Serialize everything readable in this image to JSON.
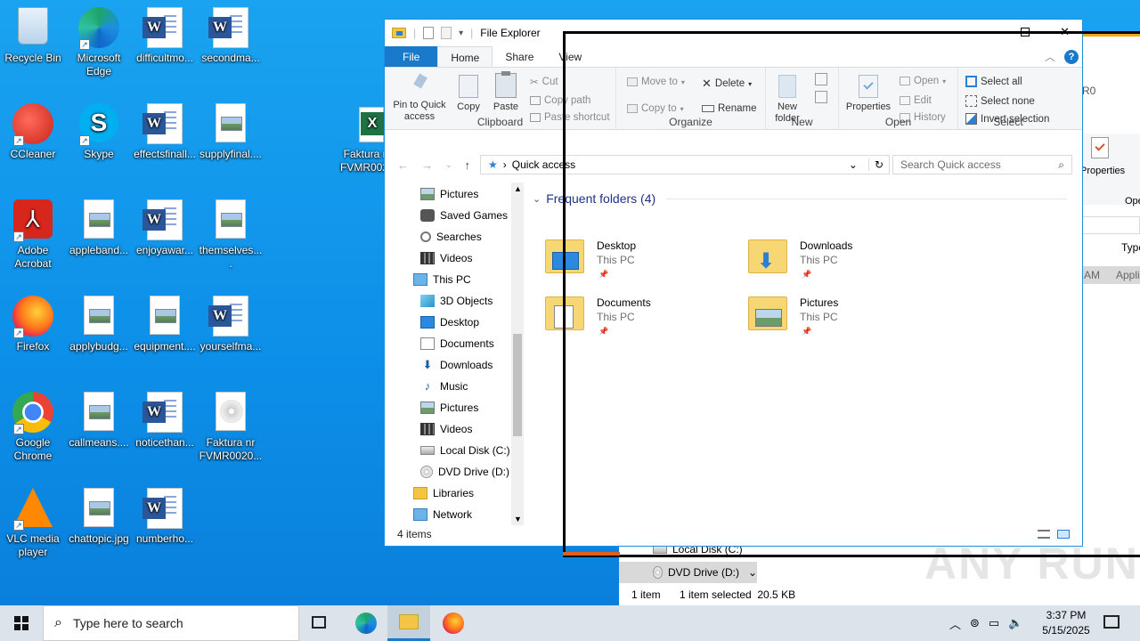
{
  "desktop": {
    "icons": [
      {
        "label": "Recycle Bin",
        "kind": "recycle-bin"
      },
      {
        "label": "Microsoft Edge",
        "kind": "edge"
      },
      {
        "label": "difficultmo...",
        "kind": "word"
      },
      {
        "label": "secondma...",
        "kind": "word"
      },
      {
        "label": "CCleaner",
        "kind": "ccleaner"
      },
      {
        "label": "Skype",
        "kind": "skype"
      },
      {
        "label": "effectsfinall...",
        "kind": "word"
      },
      {
        "label": "supplyfinal....",
        "kind": "image"
      },
      {
        "label": "Adobe Acrobat",
        "kind": "acrobat"
      },
      {
        "label": "appleband...",
        "kind": "image"
      },
      {
        "label": "enjoyawar...",
        "kind": "word"
      },
      {
        "label": "themselves....",
        "kind": "image"
      },
      {
        "label": "Firefox",
        "kind": "firefox"
      },
      {
        "label": "applybudg...",
        "kind": "image"
      },
      {
        "label": "equipment....",
        "kind": "image"
      },
      {
        "label": "yourselfma...",
        "kind": "word"
      },
      {
        "label": "Google Chrome",
        "kind": "chrome"
      },
      {
        "label": "callmeans....",
        "kind": "image"
      },
      {
        "label": "noticethan...",
        "kind": "word"
      },
      {
        "label": "Faktura nr FVMR0020...",
        "kind": "disc"
      },
      {
        "label": "VLC media player",
        "kind": "vlc"
      },
      {
        "label": "chattopic.jpg",
        "kind": "image"
      },
      {
        "label": "numberho...",
        "kind": "word"
      }
    ],
    "excel_icon": {
      "label": "Faktura n FVMR002("
    }
  },
  "explorer": {
    "title": "File Explorer",
    "tabs": {
      "file": "File",
      "home": "Home",
      "share": "Share",
      "view": "View"
    },
    "ribbon": {
      "clipboard": {
        "label": "Clipboard",
        "pin": "Pin to Quick access",
        "copy": "Copy",
        "paste": "Paste",
        "cut": "Cut",
        "copy_path": "Copy path",
        "paste_shortcut": "Paste shortcut"
      },
      "organize": {
        "label": "Organize",
        "move_to": "Move to",
        "copy_to": "Copy to",
        "delete": "Delete",
        "rename": "Rename"
      },
      "new": {
        "label": "New",
        "new_folder": "New folder"
      },
      "open": {
        "label": "Open",
        "properties": "Properties",
        "open": "Open",
        "edit": "Edit",
        "history": "History"
      },
      "select": {
        "label": "Select",
        "select_all": "Select all",
        "select_none": "Select none",
        "invert": "Invert selection"
      }
    },
    "address": {
      "path": "Quick access"
    },
    "search": {
      "placeholder": "Search Quick access"
    },
    "nav": [
      {
        "label": "Pictures",
        "icon": "pictures-icon"
      },
      {
        "label": "Saved Games",
        "icon": "saved-games-icon"
      },
      {
        "label": "Searches",
        "icon": "searches-icon"
      },
      {
        "label": "Videos",
        "icon": "videos-icon"
      },
      {
        "label": "This PC",
        "icon": "this-pc-icon"
      },
      {
        "label": "3D Objects",
        "icon": "3d-objects-icon"
      },
      {
        "label": "Desktop",
        "icon": "desktop-icon"
      },
      {
        "label": "Documents",
        "icon": "documents-icon"
      },
      {
        "label": "Downloads",
        "icon": "downloads-icon"
      },
      {
        "label": "Music",
        "icon": "music-icon"
      },
      {
        "label": "Pictures",
        "icon": "pictures-icon"
      },
      {
        "label": "Videos",
        "icon": "videos-icon"
      },
      {
        "label": "Local Disk (C:)",
        "icon": "local-disk-icon"
      },
      {
        "label": "DVD Drive (D:)",
        "icon": "dvd-drive-icon"
      },
      {
        "label": "Libraries",
        "icon": "libraries-icon"
      },
      {
        "label": "Network",
        "icon": "network-icon"
      }
    ],
    "section_title": "Frequent folders (4)",
    "folders": [
      {
        "name": "Desktop",
        "location": "This PC"
      },
      {
        "name": "Downloads",
        "location": "This PC"
      },
      {
        "name": "Documents",
        "location": "This PC"
      },
      {
        "name": "Pictures",
        "location": "This PC"
      }
    ],
    "status": "4 items"
  },
  "bg_window": {
    "title_fragment": "R0",
    "properties": "Properties",
    "open_fragment": "Open",
    "type_header": "Type",
    "row_time": "AM",
    "row_type": "Appli",
    "nav_local": "Local Disk (C:)",
    "nav_dvd": "DVD Drive (D:)",
    "status_count": "1 item",
    "status_selected": "1 item selected  20.5 KB"
  },
  "watermark": "ANY RUN",
  "taskbar": {
    "search_placeholder": "Type here to search",
    "time": "3:37 PM",
    "date": "5/15/2025"
  },
  "colors": {
    "accent": "#1979ca",
    "desktop": "#0c8fe8",
    "selection": "#cce8ff"
  }
}
